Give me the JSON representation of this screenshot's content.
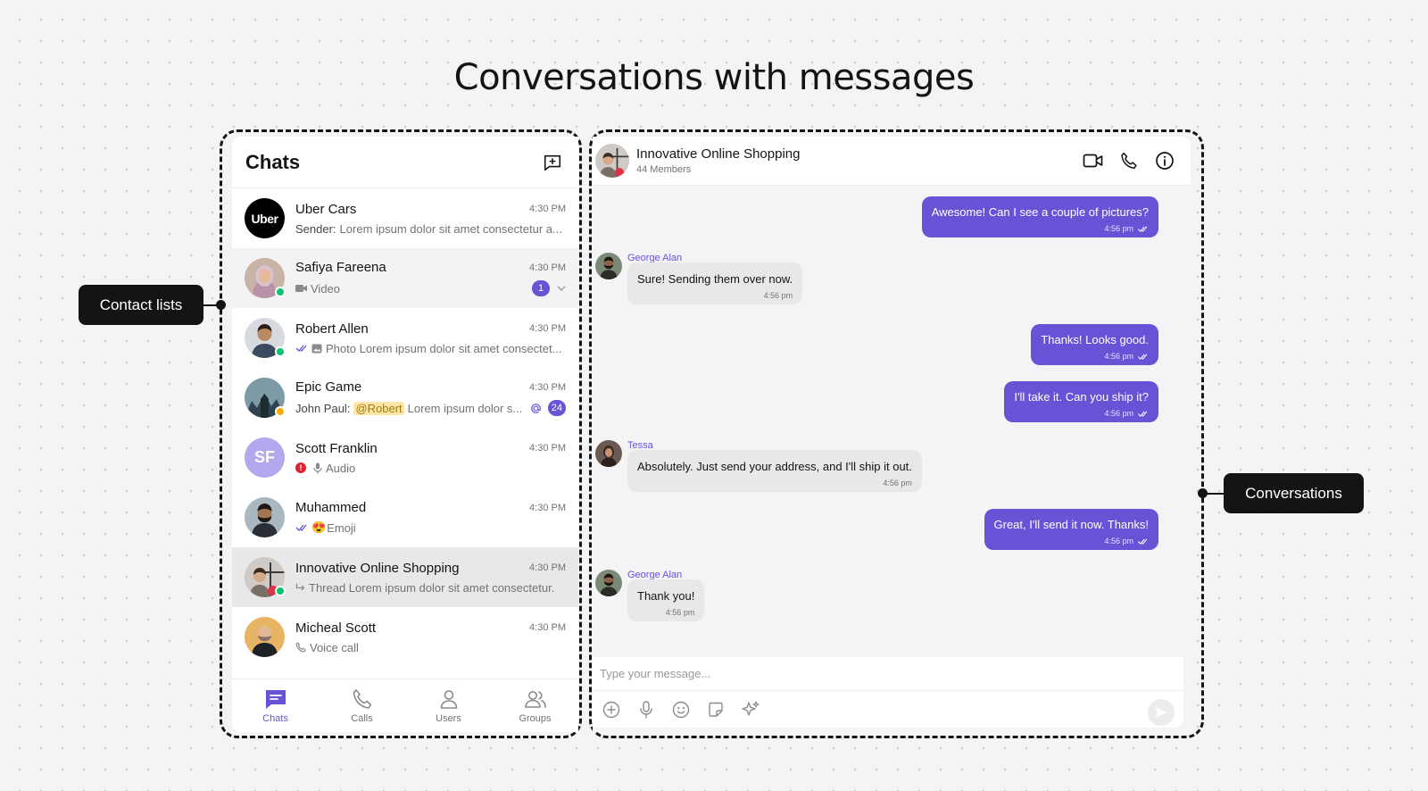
{
  "page_title": "Conversations with messages",
  "callouts": {
    "left": "Contact lists",
    "right": "Conversations"
  },
  "chats": {
    "title": "Chats",
    "items": [
      {
        "name": "Uber Cars",
        "time": "4:30 PM",
        "sender": "Sender:",
        "preview": "Lorem ipsum dolor sit amet consectetur a...",
        "avatar": "Uber"
      },
      {
        "name": "Safiya Fareena",
        "time": "4:30 PM",
        "preview": "Video",
        "badge": "1"
      },
      {
        "name": "Robert Allen",
        "time": "4:30 PM",
        "preview": "Photo Lorem ipsum dolor sit amet consectet..."
      },
      {
        "name": "Epic Game",
        "time": "4:30 PM",
        "sender": "John Paul:",
        "mention": "@Robert",
        "preview": "Lorem ipsum dolor s...",
        "badge": "24"
      },
      {
        "name": "Scott Franklin",
        "time": "4:30 PM",
        "preview": "Audio",
        "initials": "SF",
        "error_mark": "!"
      },
      {
        "name": "Muhammed",
        "time": "4:30 PM",
        "preview": "Emoji",
        "emoji": "😍"
      },
      {
        "name": "Innovative Online Shopping",
        "time": "4:30 PM",
        "preview": "Thread Lorem ipsum dolor sit amet consectetur."
      },
      {
        "name": "Micheal Scott",
        "time": "4:30 PM",
        "preview": "Voice call"
      }
    ]
  },
  "nav": [
    "Chats",
    "Calls",
    "Users",
    "Groups"
  ],
  "conversation": {
    "title": "Innovative Online Shopping",
    "subtitle": "44 Members",
    "messages": [
      {
        "text": "Awesome! Can I see a couple of pictures?",
        "time": "4:56 pm"
      },
      {
        "sender": "George Alan",
        "text": "Sure! Sending them over now.",
        "time": "4:56 pm"
      },
      {
        "text": "Thanks! Looks good.",
        "time": "4:56 pm"
      },
      {
        "text": "I'll take it. Can you ship it?",
        "time": "4:56 pm"
      },
      {
        "sender": "Tessa",
        "text": "Absolutely. Just send your address, and I'll ship it out.",
        "time": "4:56 pm"
      },
      {
        "text": "Great, I'll send it now. Thanks!",
        "time": "4:56 pm"
      },
      {
        "sender": "George Alan",
        "text": "Thank you!",
        "time": "4:56 pm"
      }
    ],
    "composer_placeholder": "Type your message..."
  },
  "colors": {
    "accent": "#6852d6",
    "ink": "#141414",
    "online": "#09c26f",
    "error": "#e0212f"
  }
}
